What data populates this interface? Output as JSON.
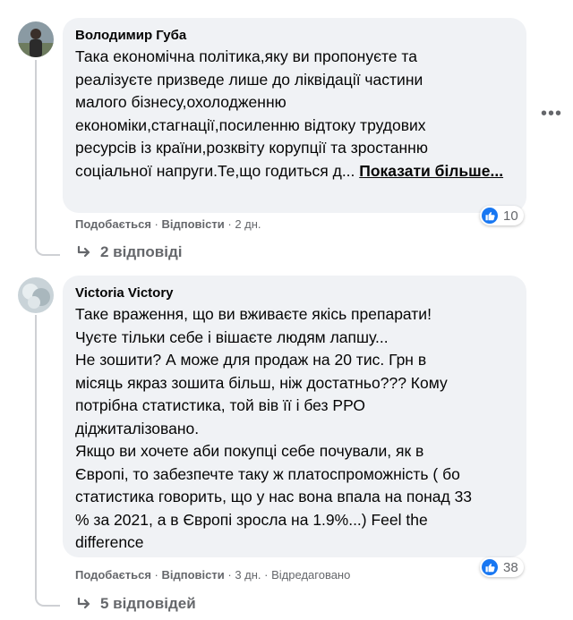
{
  "comments": [
    {
      "author": "Володимир Губа",
      "text": "Така економічна політика,яку ви пропонуєте та\nреалізуєте призведе лише до ліквідації частини\nмалого бізнесу,охолодженню\nекономіки,стагнації,посиленню відтоку трудових\nресурсів із країни,розквіту корупції та зростанню\nсоціальної напруги.Те,що годиться д... ",
      "see_more": "Показати більше...",
      "like_label": "Подобається",
      "reply_label": "Відповісти",
      "time": "2 дн.",
      "reaction_count": "10",
      "replies_label": "2 відповіді",
      "icons": {
        "avatar": "avatar-photo",
        "reaction": "like-icon",
        "replies": "reply-arrow-icon"
      }
    },
    {
      "author": "Victoria Victory",
      "text": "Таке враження, що ви вживаєте якісь препарати!\nЧуєте тільки себе і вішаєте людям лапшу...\nНе зошити? А може для продаж на 20 тис. Грн в\nмісяць якраз зошита більш, ніж достатньо??? Кому\nпотрібна статистика, той вів її і без РРО\nдіджиталізовано.\nЯкщо ви хочете аби покупці себе почували, як в\nЄвропі, то забезпечте таку ж платоспроможність ( бо\nстатистика говорить, що у нас вона впала на понад 33\n% за 2021, а в Європі зросла на 1.9%...) Feel the\ndifference",
      "like_label": "Подобається",
      "reply_label": "Відповісти",
      "time": "3 дн.",
      "edited": "Відредаговано",
      "reaction_count": "38",
      "replies_label": "5 відповідей",
      "icons": {
        "avatar": "avatar-photo",
        "reaction": "like-icon",
        "replies": "reply-arrow-icon"
      }
    }
  ],
  "more_options_icon": "more-options-icon",
  "colors": {
    "like_blue": "#1877f2",
    "bubble": "#f0f2f5",
    "secondary_text": "#65676b"
  }
}
